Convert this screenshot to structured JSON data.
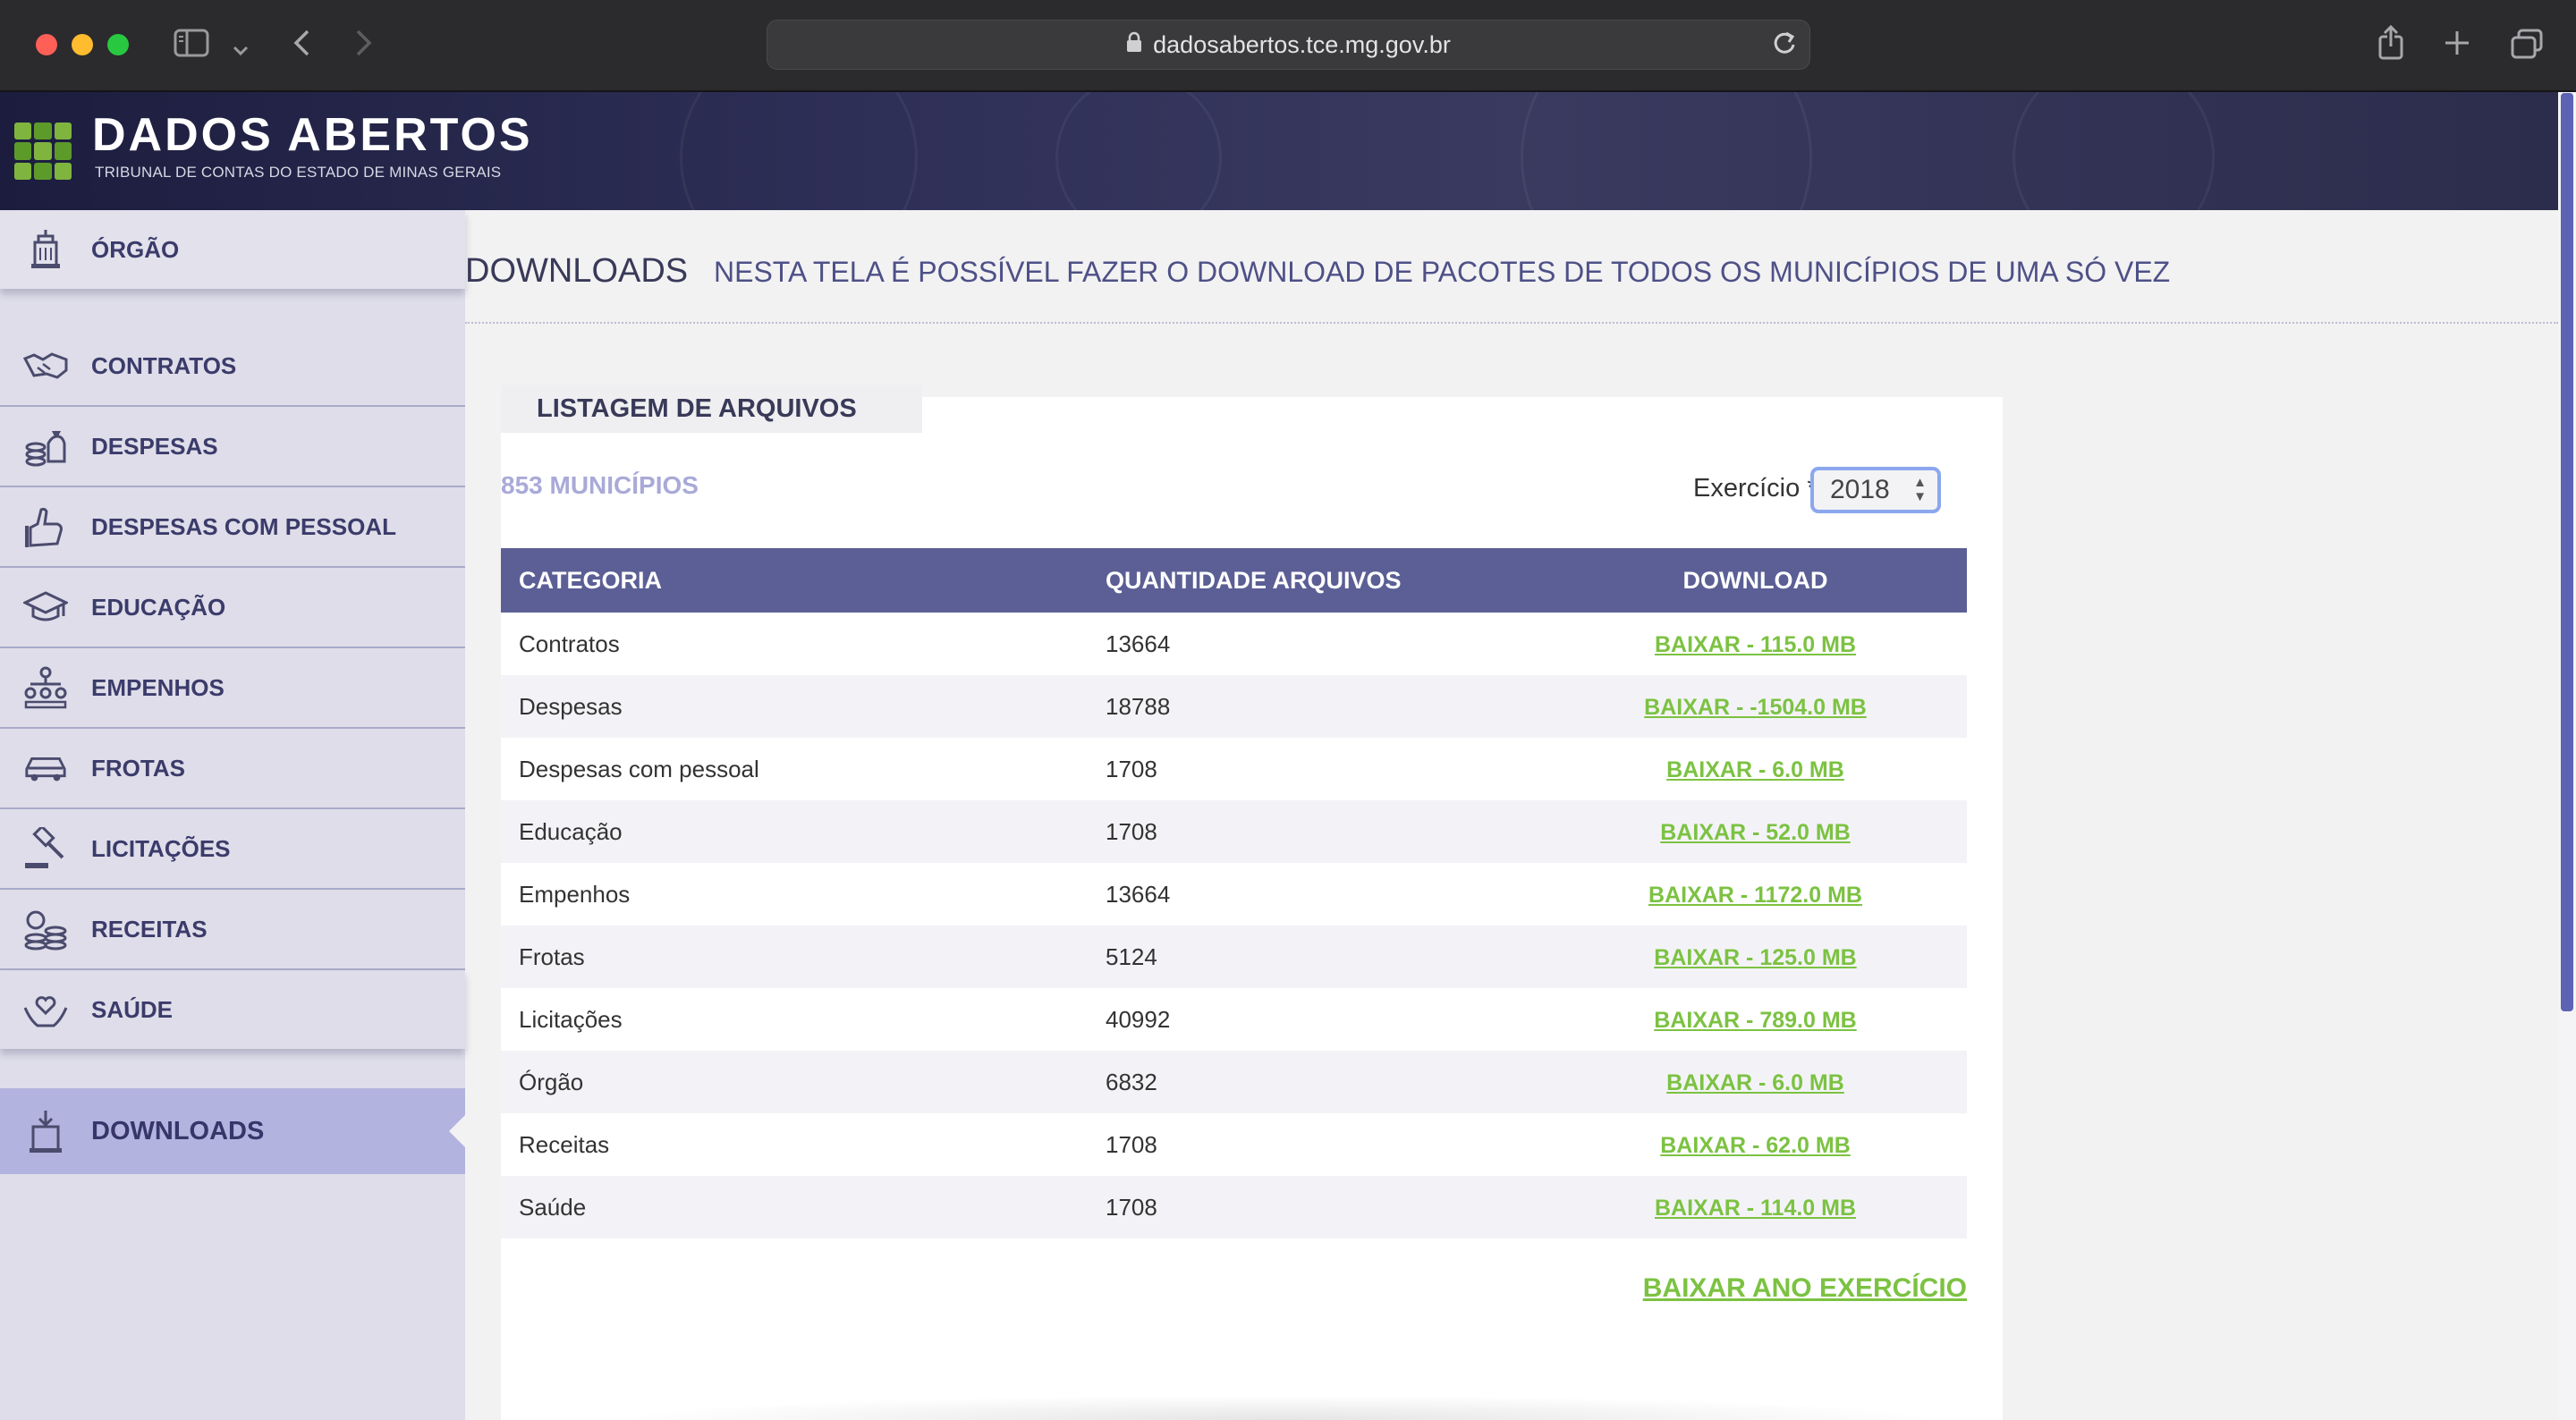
{
  "browser": {
    "url": "dadosabertos.tce.mg.gov.br"
  },
  "header": {
    "title": "DADOS ABERTOS",
    "subtitle": "TRIBUNAL DE CONTAS DO ESTADO DE MINAS GERAIS",
    "logo_color": "#7fb43f"
  },
  "sidebar": {
    "items": [
      {
        "label": "ÓRGÃO",
        "icon": "building-icon"
      },
      {
        "label": "CONTRATOS",
        "icon": "handshake-icon"
      },
      {
        "label": "DESPESAS",
        "icon": "money-bag-icon"
      },
      {
        "label": "DESPESAS COM PESSOAL",
        "icon": "hand-icon"
      },
      {
        "label": "EDUCAÇÃO",
        "icon": "graduation-cap-icon"
      },
      {
        "label": "EMPENHOS",
        "icon": "org-chart-icon"
      },
      {
        "label": "FROTAS",
        "icon": "car-icon"
      },
      {
        "label": "LICITAÇÕES",
        "icon": "gavel-icon"
      },
      {
        "label": "RECEITAS",
        "icon": "coins-icon"
      },
      {
        "label": "SAÚDE",
        "icon": "heart-hands-icon"
      }
    ],
    "active": {
      "label": "DOWNLOADS",
      "icon": "download-icon"
    }
  },
  "main": {
    "heading": "DOWNLOADS",
    "description": "NESTA TELA É POSSÍVEL FAZER O DOWNLOAD DE PACOTES DE TODOS OS MUNICÍPIOS DE UMA SÓ VEZ",
    "card_title": "LISTAGEM DE ARQUIVOS",
    "municipalities": "853 MUNICÍPIOS",
    "exercicio_label": "Exercício *",
    "exercicio_value": "2018",
    "columns": [
      "CATEGORIA",
      "QUANTIDADE ARQUIVOS",
      "DOWNLOAD"
    ],
    "rows": [
      {
        "category": "Contratos",
        "count": "13664",
        "download": "BAIXAR - 115.0 MB"
      },
      {
        "category": "Despesas",
        "count": "18788",
        "download": "BAIXAR - -1504.0 MB"
      },
      {
        "category": "Despesas com pessoal",
        "count": "1708",
        "download": "BAIXAR - 6.0 MB"
      },
      {
        "category": "Educação",
        "count": "1708",
        "download": "BAIXAR - 52.0 MB"
      },
      {
        "category": "Empenhos",
        "count": "13664",
        "download": "BAIXAR - 1172.0 MB"
      },
      {
        "category": "Frotas",
        "count": "5124",
        "download": "BAIXAR - 125.0 MB"
      },
      {
        "category": "Licitações",
        "count": "40992",
        "download": "BAIXAR - 789.0 MB"
      },
      {
        "category": "Órgão",
        "count": "6832",
        "download": "BAIXAR - 6.0 MB"
      },
      {
        "category": "Receitas",
        "count": "1708",
        "download": "BAIXAR - 62.0 MB"
      },
      {
        "category": "Saúde",
        "count": "1708",
        "download": "BAIXAR - 114.0 MB"
      }
    ],
    "download_year": "BAIXAR ANO EXERCÍCIO",
    "link_color": "#7cc242",
    "table_header_color": "#5b5f95"
  }
}
